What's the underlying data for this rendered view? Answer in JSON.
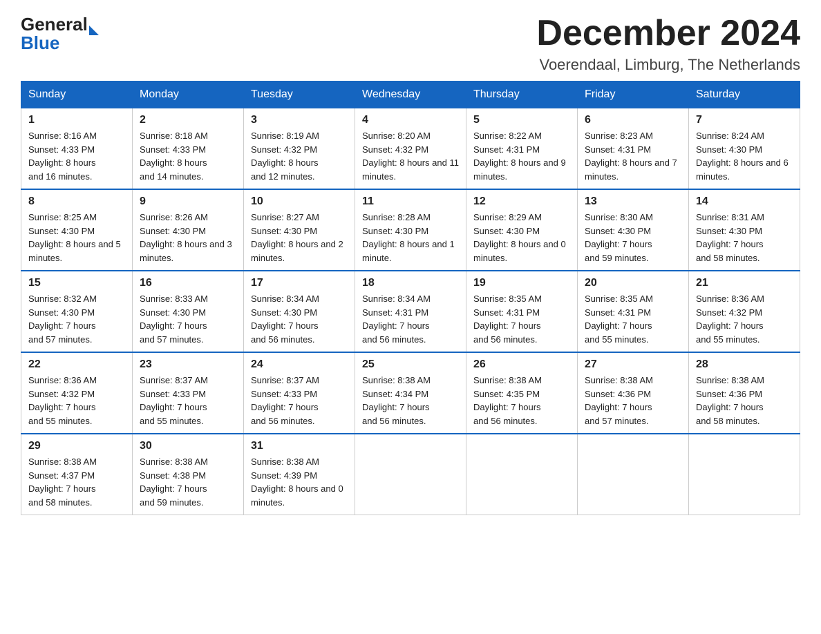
{
  "header": {
    "logo_general": "General",
    "logo_blue": "Blue",
    "month_title": "December 2024",
    "location": "Voerendaal, Limburg, The Netherlands"
  },
  "weekdays": [
    "Sunday",
    "Monday",
    "Tuesday",
    "Wednesday",
    "Thursday",
    "Friday",
    "Saturday"
  ],
  "weeks": [
    [
      {
        "day": "1",
        "sunrise": "8:16 AM",
        "sunset": "4:33 PM",
        "daylight": "8 hours and 16 minutes."
      },
      {
        "day": "2",
        "sunrise": "8:18 AM",
        "sunset": "4:33 PM",
        "daylight": "8 hours and 14 minutes."
      },
      {
        "day": "3",
        "sunrise": "8:19 AM",
        "sunset": "4:32 PM",
        "daylight": "8 hours and 12 minutes."
      },
      {
        "day": "4",
        "sunrise": "8:20 AM",
        "sunset": "4:32 PM",
        "daylight": "8 hours and 11 minutes."
      },
      {
        "day": "5",
        "sunrise": "8:22 AM",
        "sunset": "4:31 PM",
        "daylight": "8 hours and 9 minutes."
      },
      {
        "day": "6",
        "sunrise": "8:23 AM",
        "sunset": "4:31 PM",
        "daylight": "8 hours and 7 minutes."
      },
      {
        "day": "7",
        "sunrise": "8:24 AM",
        "sunset": "4:30 PM",
        "daylight": "8 hours and 6 minutes."
      }
    ],
    [
      {
        "day": "8",
        "sunrise": "8:25 AM",
        "sunset": "4:30 PM",
        "daylight": "8 hours and 5 minutes."
      },
      {
        "day": "9",
        "sunrise": "8:26 AM",
        "sunset": "4:30 PM",
        "daylight": "8 hours and 3 minutes."
      },
      {
        "day": "10",
        "sunrise": "8:27 AM",
        "sunset": "4:30 PM",
        "daylight": "8 hours and 2 minutes."
      },
      {
        "day": "11",
        "sunrise": "8:28 AM",
        "sunset": "4:30 PM",
        "daylight": "8 hours and 1 minute."
      },
      {
        "day": "12",
        "sunrise": "8:29 AM",
        "sunset": "4:30 PM",
        "daylight": "8 hours and 0 minutes."
      },
      {
        "day": "13",
        "sunrise": "8:30 AM",
        "sunset": "4:30 PM",
        "daylight": "7 hours and 59 minutes."
      },
      {
        "day": "14",
        "sunrise": "8:31 AM",
        "sunset": "4:30 PM",
        "daylight": "7 hours and 58 minutes."
      }
    ],
    [
      {
        "day": "15",
        "sunrise": "8:32 AM",
        "sunset": "4:30 PM",
        "daylight": "7 hours and 57 minutes."
      },
      {
        "day": "16",
        "sunrise": "8:33 AM",
        "sunset": "4:30 PM",
        "daylight": "7 hours and 57 minutes."
      },
      {
        "day": "17",
        "sunrise": "8:34 AM",
        "sunset": "4:30 PM",
        "daylight": "7 hours and 56 minutes."
      },
      {
        "day": "18",
        "sunrise": "8:34 AM",
        "sunset": "4:31 PM",
        "daylight": "7 hours and 56 minutes."
      },
      {
        "day": "19",
        "sunrise": "8:35 AM",
        "sunset": "4:31 PM",
        "daylight": "7 hours and 56 minutes."
      },
      {
        "day": "20",
        "sunrise": "8:35 AM",
        "sunset": "4:31 PM",
        "daylight": "7 hours and 55 minutes."
      },
      {
        "day": "21",
        "sunrise": "8:36 AM",
        "sunset": "4:32 PM",
        "daylight": "7 hours and 55 minutes."
      }
    ],
    [
      {
        "day": "22",
        "sunrise": "8:36 AM",
        "sunset": "4:32 PM",
        "daylight": "7 hours and 55 minutes."
      },
      {
        "day": "23",
        "sunrise": "8:37 AM",
        "sunset": "4:33 PM",
        "daylight": "7 hours and 55 minutes."
      },
      {
        "day": "24",
        "sunrise": "8:37 AM",
        "sunset": "4:33 PM",
        "daylight": "7 hours and 56 minutes."
      },
      {
        "day": "25",
        "sunrise": "8:38 AM",
        "sunset": "4:34 PM",
        "daylight": "7 hours and 56 minutes."
      },
      {
        "day": "26",
        "sunrise": "8:38 AM",
        "sunset": "4:35 PM",
        "daylight": "7 hours and 56 minutes."
      },
      {
        "day": "27",
        "sunrise": "8:38 AM",
        "sunset": "4:36 PM",
        "daylight": "7 hours and 57 minutes."
      },
      {
        "day": "28",
        "sunrise": "8:38 AM",
        "sunset": "4:36 PM",
        "daylight": "7 hours and 58 minutes."
      }
    ],
    [
      {
        "day": "29",
        "sunrise": "8:38 AM",
        "sunset": "4:37 PM",
        "daylight": "7 hours and 58 minutes."
      },
      {
        "day": "30",
        "sunrise": "8:38 AM",
        "sunset": "4:38 PM",
        "daylight": "7 hours and 59 minutes."
      },
      {
        "day": "31",
        "sunrise": "8:38 AM",
        "sunset": "4:39 PM",
        "daylight": "8 hours and 0 minutes."
      },
      null,
      null,
      null,
      null
    ]
  ],
  "labels": {
    "sunrise": "Sunrise:",
    "sunset": "Sunset:",
    "daylight": "Daylight:"
  }
}
